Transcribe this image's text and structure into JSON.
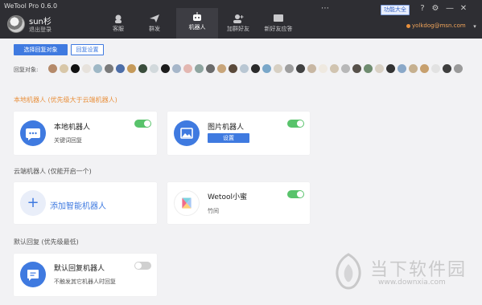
{
  "titlebar": {
    "app_title": "WeTool Pro 0.6.0",
    "username": "sun杉",
    "logout": "退出登录",
    "func_btn": "功能大全",
    "email": "yolkdog@msn.com",
    "dropdown": "▾"
  },
  "nav": {
    "tabs": [
      {
        "label": "客服",
        "icon": "headset-icon"
      },
      {
        "label": "群发",
        "icon": "send-icon"
      },
      {
        "label": "机器人",
        "icon": "robot-icon",
        "active": true
      },
      {
        "label": "加群好友",
        "icon": "add-friend-icon"
      },
      {
        "label": "新好友应答",
        "icon": "message-icon"
      }
    ]
  },
  "toolbar_icons": {
    "more": "⋯",
    "help": "?",
    "settings": "⚙",
    "minimize": "—",
    "close": "✕"
  },
  "controls": {
    "select_btn": "选择回复对象",
    "reset_btn": "回复设置",
    "reply_label": "回复对象:"
  },
  "sections": {
    "local": "本地机器人 (优先级大于云端机器人)",
    "cloud": "云端机器人 (仅能开启一个)",
    "default": "默认回复 (优先级最低)"
  },
  "cards": {
    "local_robot": {
      "title": "本地机器人",
      "sub": "关键词回复",
      "enabled": true
    },
    "image_robot": {
      "title": "图片机器人",
      "button": "设置",
      "enabled": true
    },
    "add_robot": {
      "icon": "+",
      "title": "添加智能机器人"
    },
    "wetool": {
      "title": "Wetool小蜜",
      "sub": "竹间",
      "enabled": true
    },
    "default_robot": {
      "title": "默认回复机器人",
      "sub": "不触发其它机器人时回复",
      "enabled": false
    }
  },
  "watermark": {
    "text": "当下软件园",
    "url": "www.downxia.com"
  },
  "colors": {
    "accent": "#3f7ae0",
    "titlebar": "#2e2e33",
    "toggle_on": "#58c36b",
    "orange": "#e9903c"
  }
}
